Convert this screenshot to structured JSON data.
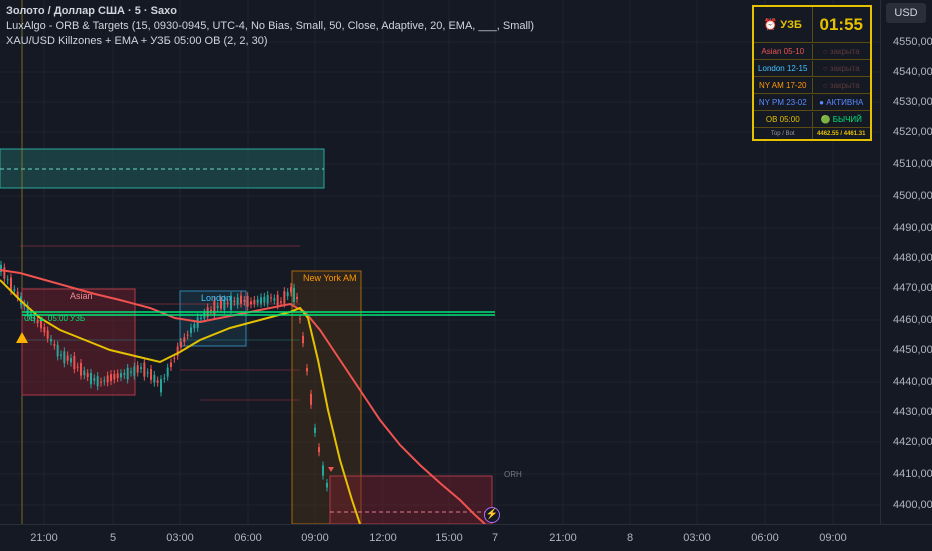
{
  "legend": {
    "title": "Золото / Доллар США · 5 · Saxo",
    "indicator1": "LuxAlgo - ORB & Targets (15, 0930-0945, UTC-4, No Bias, Small, 50, Close, Adaptive, 20, EMA, ___, Small)",
    "indicator2": "XAU/USD Killzones + EMA + УЗБ 05:00 OB (2, 2, 30)"
  },
  "currency": "USD",
  "price_ticks": [
    "4550,00",
    "4540,00",
    "4530,00",
    "4520,00",
    "4510,00",
    "4500,00",
    "4490,00",
    "4480,00",
    "4470,00",
    "4460,00",
    "4450,00",
    "4440,00",
    "4430,00",
    "4420,00",
    "4410,00",
    "4400,00"
  ],
  "time_ticks": [
    "21:00",
    "5",
    "03:00",
    "06:00",
    "09:00",
    "12:00",
    "15:00",
    "7",
    "21:00",
    "8",
    "03:00",
    "06:00",
    "09:00"
  ],
  "labels": {
    "asian": "Asian",
    "london": "London",
    "ny_am": "New York AM",
    "ob": "OB ▲ 05:00 УЗБ",
    "orh": "ORH"
  },
  "table": {
    "header_label": "⏰ УЗБ",
    "clock": "01:55",
    "rows": [
      {
        "name": "Asian  05-10",
        "status": "○ закрыта",
        "color": "#ef5350"
      },
      {
        "name": "London  12-15",
        "status": "○ закрыта",
        "color": "#42c6ff"
      },
      {
        "name": "NY AM  17-20",
        "status": "○ закрыта",
        "color": "#ff9800"
      },
      {
        "name": "NY PM  23-02",
        "status": "● АКТИВНА",
        "color": "#5b8cff"
      },
      {
        "name": "OB 05:00",
        "status": "🟢 БЫЧИЙ",
        "color": "#e5c100"
      }
    ],
    "footer_label": "Top / Bot",
    "footer_value": "4462.55 / 4461.31"
  },
  "colors": {
    "background": "#151924",
    "up": "#26a69a",
    "down": "#ef5350",
    "ema_fast": "#e5c100",
    "ema_slow": "#ef5350",
    "ob_line": "#00e676",
    "asian_box": "#7a1f2b",
    "london_box": "#42c6ff",
    "ny_box": "#ff9800"
  }
}
